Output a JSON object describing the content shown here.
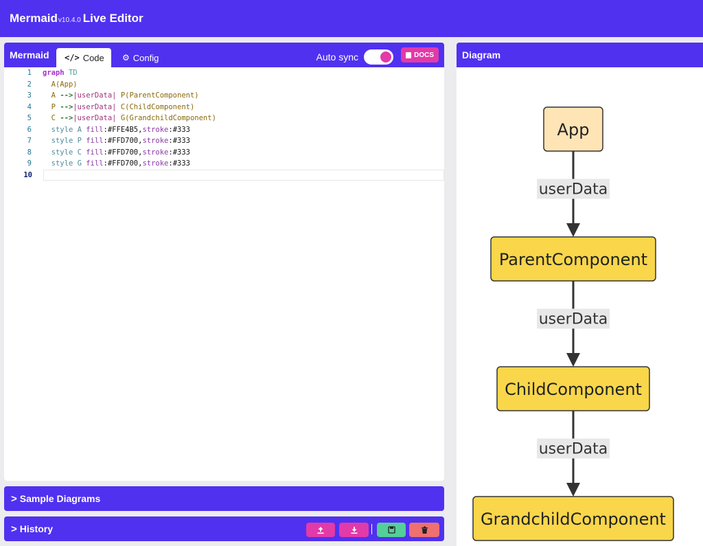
{
  "header": {
    "brand": "Mermaid",
    "version": "v10.4.0",
    "title": "Live Editor"
  },
  "editor": {
    "panel_title": "Mermaid",
    "tabs": [
      {
        "label": "Code",
        "icon": "code-icon"
      },
      {
        "label": "Config",
        "icon": "gears-icon"
      }
    ],
    "autosync_label": "Auto sync",
    "docs_label": "DOCS",
    "lines": [
      {
        "n": "1",
        "parts": [
          [
            "kw",
            "graph"
          ],
          [
            "plain",
            " "
          ],
          [
            "dir",
            "TD"
          ]
        ]
      },
      {
        "n": "2",
        "parts": [
          [
            "plain",
            "  "
          ],
          [
            "nd",
            "A(App)"
          ]
        ]
      },
      {
        "n": "3",
        "parts": [
          [
            "plain",
            "  "
          ],
          [
            "nd",
            "A "
          ],
          [
            "arrow",
            "-->"
          ],
          [
            "lbl",
            "|userData|"
          ],
          [
            "plain",
            " "
          ],
          [
            "nd",
            "P(ParentComponent)"
          ]
        ]
      },
      {
        "n": "4",
        "parts": [
          [
            "plain",
            "  "
          ],
          [
            "nd",
            "P "
          ],
          [
            "arrow",
            "-->"
          ],
          [
            "lbl",
            "|userData|"
          ],
          [
            "plain",
            " "
          ],
          [
            "nd",
            "C(ChildComponent)"
          ]
        ]
      },
      {
        "n": "5",
        "parts": [
          [
            "plain",
            "  "
          ],
          [
            "nd",
            "C "
          ],
          [
            "arrow",
            "-->"
          ],
          [
            "lbl",
            "|userData|"
          ],
          [
            "plain",
            " "
          ],
          [
            "nd",
            "G(GrandchildComponent)"
          ]
        ]
      },
      {
        "n": "6",
        "parts": [
          [
            "plain",
            "  "
          ],
          [
            "sty",
            "style A "
          ],
          [
            "prop",
            "fill"
          ],
          [
            "val",
            ":#FFE4B5,"
          ],
          [
            "prop",
            "stroke"
          ],
          [
            "val",
            ":#333"
          ]
        ]
      },
      {
        "n": "7",
        "parts": [
          [
            "plain",
            "  "
          ],
          [
            "sty",
            "style P "
          ],
          [
            "prop",
            "fill"
          ],
          [
            "val",
            ":#FFD700,"
          ],
          [
            "prop",
            "stroke"
          ],
          [
            "val",
            ":#333"
          ]
        ]
      },
      {
        "n": "8",
        "parts": [
          [
            "plain",
            "  "
          ],
          [
            "sty",
            "style C "
          ],
          [
            "prop",
            "fill"
          ],
          [
            "val",
            ":#FFD700,"
          ],
          [
            "prop",
            "stroke"
          ],
          [
            "val",
            ":#333"
          ]
        ]
      },
      {
        "n": "9",
        "parts": [
          [
            "plain",
            "  "
          ],
          [
            "sty",
            "style G "
          ],
          [
            "prop",
            "fill"
          ],
          [
            "val",
            ":#FFD700,"
          ],
          [
            "prop",
            "stroke"
          ],
          [
            "val",
            ":#333"
          ]
        ]
      },
      {
        "n": "10",
        "parts": []
      }
    ]
  },
  "sample_diagrams": {
    "label": "Sample Diagrams"
  },
  "history": {
    "label": "History",
    "buttons": [
      {
        "name": "upload-icon",
        "color": "#e23aa8"
      },
      {
        "name": "download-icon",
        "color": "#e23aa8"
      },
      {
        "name": "save-icon",
        "color": "#55cf9a"
      },
      {
        "name": "trash-icon",
        "color": "#ee7070"
      }
    ]
  },
  "diagram": {
    "panel_title": "Diagram",
    "nodes": [
      {
        "id": "A",
        "label": "App",
        "fill": "#FFE4B5"
      },
      {
        "id": "P",
        "label": "ParentComponent",
        "fill": "#FFD700"
      },
      {
        "id": "C",
        "label": "ChildComponent",
        "fill": "#FFD700"
      },
      {
        "id": "G",
        "label": "GrandchildComponent",
        "fill": "#FFD700"
      }
    ],
    "edges": [
      {
        "from": "A",
        "to": "P",
        "label": "userData"
      },
      {
        "from": "P",
        "to": "C",
        "label": "userData"
      },
      {
        "from": "C",
        "to": "G",
        "label": "userData"
      }
    ],
    "colors": {
      "stroke": "#333333",
      "edge_label_bg": "#e8e8e8"
    }
  },
  "colors": {
    "primary": "#5031f0",
    "accent": "#e23aa8"
  }
}
